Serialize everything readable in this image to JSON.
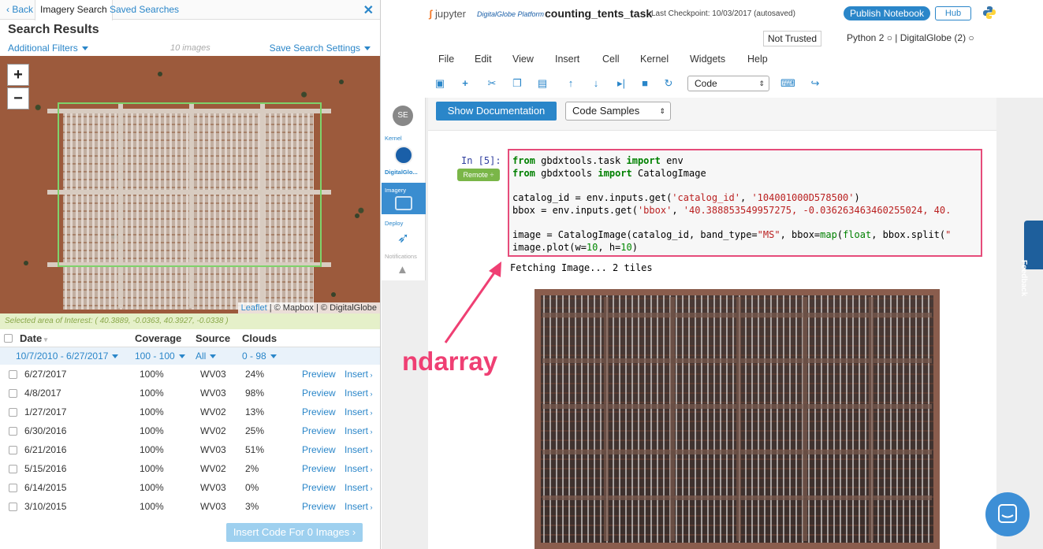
{
  "left_panel": {
    "tabs": {
      "back": "Back",
      "imagery_search": "Imagery Search",
      "saved_searches": "Saved Searches",
      "close": "✕"
    },
    "title": "Search Results",
    "additional_filters": "Additional Filters",
    "image_count": "10 images",
    "save_search_settings": "Save Search Settings",
    "map": {
      "zoom_in": "+",
      "zoom_out": "−",
      "attribution_leaflet": "Leaflet",
      "attribution_rest": " | © Mapbox | © DigitalGlobe"
    },
    "aoi_text": "Selected area of Interest: ( 40.3889, -0.0363, 40.3927, -0.0338 )",
    "table": {
      "headers": {
        "date": "Date",
        "coverage": "Coverage",
        "source": "Source",
        "clouds": "Clouds"
      },
      "filters": {
        "date": "10/7/2010 - 6/27/2017",
        "coverage": "100 - 100",
        "source": "All",
        "clouds": "0 - 98"
      },
      "rows": [
        {
          "date": "6/27/2017",
          "coverage": "100%",
          "source": "WV03",
          "clouds": "24%"
        },
        {
          "date": "4/8/2017",
          "coverage": "100%",
          "source": "WV03",
          "clouds": "98%"
        },
        {
          "date": "1/27/2017",
          "coverage": "100%",
          "source": "WV02",
          "clouds": "13%"
        },
        {
          "date": "6/30/2016",
          "coverage": "100%",
          "source": "WV02",
          "clouds": "25%"
        },
        {
          "date": "6/21/2016",
          "coverage": "100%",
          "source": "WV03",
          "clouds": "51%"
        },
        {
          "date": "5/15/2016",
          "coverage": "100%",
          "source": "WV02",
          "clouds": "2%"
        },
        {
          "date": "6/14/2015",
          "coverage": "100%",
          "source": "WV03",
          "clouds": "0%"
        },
        {
          "date": "3/10/2015",
          "coverage": "100%",
          "source": "WV03",
          "clouds": "3%"
        }
      ],
      "preview_label": "Preview",
      "insert_label": "Insert"
    },
    "insert_button": "Insert Code For 0 Images"
  },
  "jupyter": {
    "logo_text": "jupyter",
    "platform": "DigitalGlobe Platform",
    "notebook_name": "counting_tents_task",
    "checkpoint": "Last Checkpoint: 10/03/2017 (autosaved)",
    "publish": "Publish Notebook",
    "hub": "Hub",
    "trusted": "Not Trusted",
    "kernel_info": "Python 2  ○  |  DigitalGlobe (2)  ○",
    "menus": [
      "File",
      "Edit",
      "View",
      "Insert",
      "Cell",
      "Kernel",
      "Widgets",
      "Help"
    ],
    "cell_type": "Code",
    "sidebar": {
      "avatar": "SE",
      "kernel": "Kernel",
      "kernel_name": "DigitalGlo...",
      "imagery": "Imagery",
      "deploy": "Deploy",
      "notifications": "Notifications"
    },
    "show_documentation": "Show Documentation",
    "code_samples": "Code Samples",
    "prompt": "In [5]:",
    "remote": "Remote ÷",
    "output": "Fetching Image... 2 tiles",
    "annotation": "ndarray",
    "feedback": "Feedback"
  }
}
